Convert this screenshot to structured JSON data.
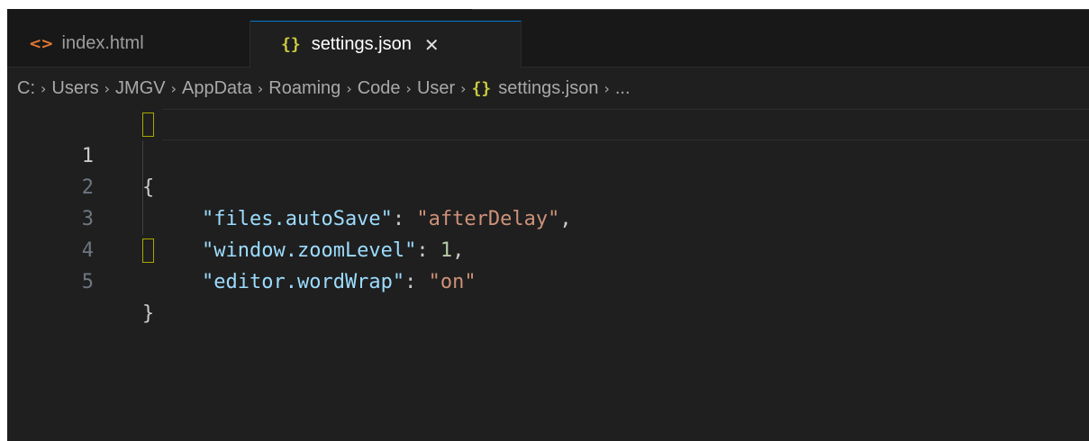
{
  "tabs": [
    {
      "icon": "<>",
      "label": "index.html",
      "active": false
    },
    {
      "icon": "{}",
      "label": "settings.json",
      "active": true,
      "close": "✕"
    }
  ],
  "breadcrumb": {
    "items": [
      "C:",
      "Users",
      "JMGV",
      "AppData",
      "Roaming",
      "Code",
      "User"
    ],
    "file_icon": "{}",
    "file": "settings.json",
    "more": "...",
    "separator": "›"
  },
  "editor": {
    "lines": [
      {
        "number": "1",
        "open_brace": "{"
      },
      {
        "number": "2",
        "key": "\"files.autoSave\"",
        "colon": ": ",
        "value": "\"afterDelay\"",
        "comma": ","
      },
      {
        "number": "3",
        "key": "\"window.zoomLevel\"",
        "colon": ": ",
        "value": "1",
        "comma": ","
      },
      {
        "number": "4",
        "key": "\"editor.wordWrap\"",
        "colon": ": ",
        "value": "\"on\"",
        "comma": ""
      },
      {
        "number": "5",
        "close_brace": "}"
      }
    ],
    "current_line": "1"
  },
  "colors": {
    "background": "#1f1f1f",
    "tabbar": "#181818",
    "accent": "#0078d4",
    "json_key": "#9cdcfe",
    "json_string": "#ce9178",
    "json_number": "#b5cea8",
    "json_icon": "#cbcb41",
    "html_icon": "#e37933"
  }
}
